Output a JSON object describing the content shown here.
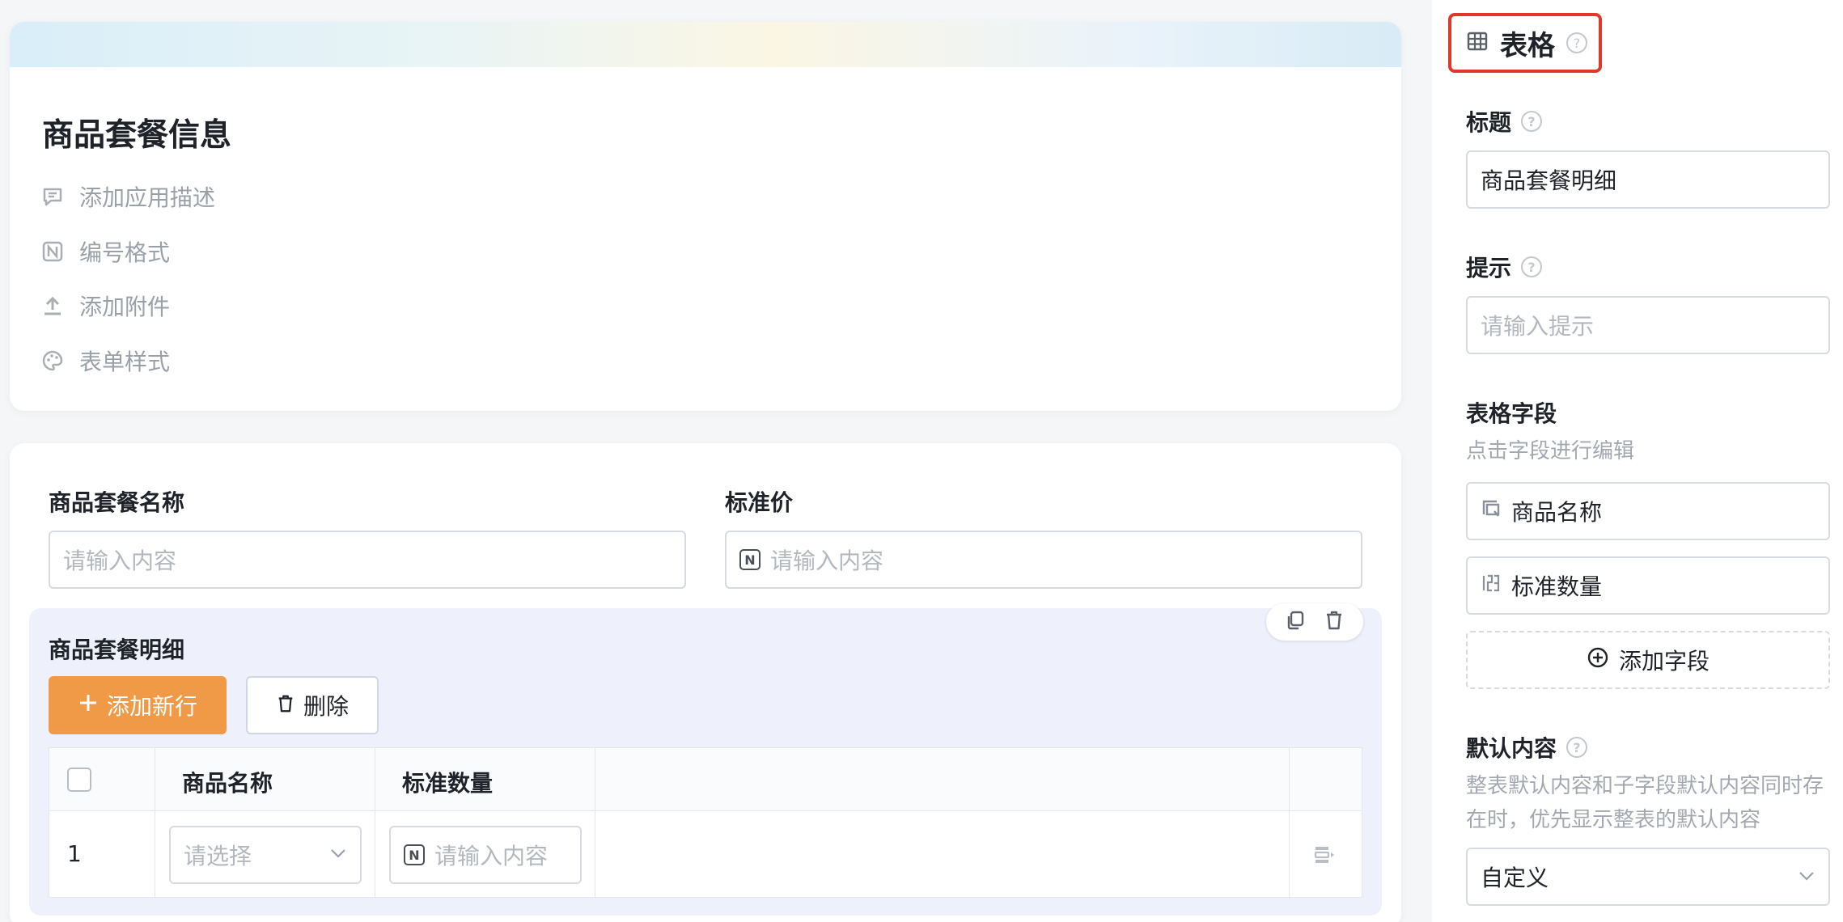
{
  "form": {
    "title": "商品套餐信息",
    "options": [
      {
        "label": "添加应用描述",
        "icon": "comment-icon"
      },
      {
        "label": "编号格式",
        "icon": "number-format-icon"
      },
      {
        "label": "添加附件",
        "icon": "upload-icon"
      },
      {
        "label": "表单样式",
        "icon": "palette-icon"
      }
    ]
  },
  "fields": {
    "name": {
      "label": "商品套餐名称",
      "placeholder": "请输入内容"
    },
    "price": {
      "label": "标准价",
      "placeholder": "请输入内容"
    }
  },
  "subform": {
    "title": "商品套餐明细",
    "add_row_label": "添加新行",
    "delete_label": "删除",
    "columns": [
      "商品名称",
      "标准数量"
    ],
    "rows": [
      {
        "index": "1",
        "name_placeholder": "请选择",
        "qty_placeholder": "请输入内容"
      }
    ]
  },
  "panel": {
    "title": "表格",
    "title_label": "标题",
    "title_value": "商品套餐明细",
    "hint_label": "提示",
    "hint_placeholder": "请输入提示",
    "fields_label": "表格字段",
    "fields_sub": "点击字段进行编辑",
    "field_items": [
      "商品名称",
      "标准数量"
    ],
    "add_field_label": "添加字段",
    "default_label": "默认内容",
    "default_sub_1": "整表默认内容和子字段默认内容同时存",
    "default_sub_2": "在时，优先显示整表的默认内容",
    "default_value": "自定义"
  },
  "colors": {
    "accent": "#f09947",
    "highlight_border": "#e0392b",
    "subform_bg": "#eef1fb"
  }
}
